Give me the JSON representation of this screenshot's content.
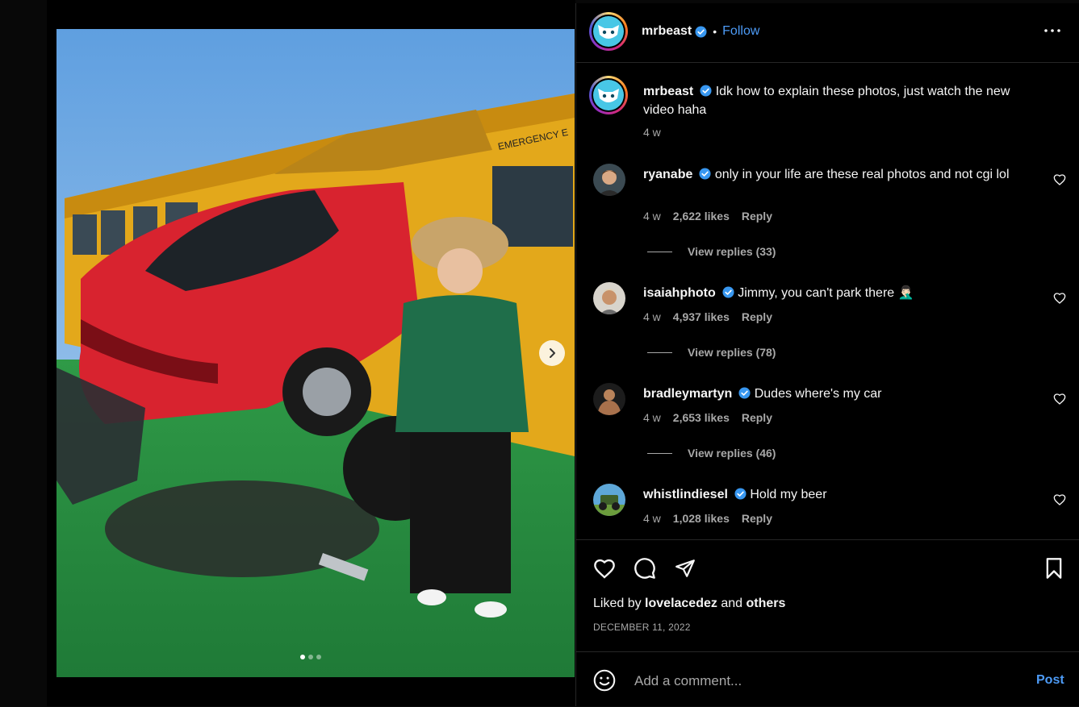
{
  "post": {
    "author": "mrbeast",
    "verified": true,
    "follow_label": "Follow",
    "header_separator": "•",
    "caption": "Idk how to explain these photos, just watch the new video haha",
    "caption_time": "4 w",
    "image_count": 3,
    "current_image": 1,
    "liked_by_prefix": "Liked by",
    "liked_by_user": "lovelacedez",
    "liked_by_and": "and",
    "liked_by_others": "others",
    "date": "DECEMBER 11, 2022"
  },
  "comments": [
    {
      "user": "ryanabe",
      "verified": true,
      "text": "only in your life are these real photos and not cgi lol",
      "time": "4 w",
      "likes": "2,622 likes",
      "reply_label": "Reply",
      "view_replies": "View replies (33)"
    },
    {
      "user": "isaiahphoto",
      "verified": true,
      "text": "Jimmy, you can't park there 🤦🏻‍♂️",
      "time": "4 w",
      "likes": "4,937 likes",
      "reply_label": "Reply",
      "view_replies": "View replies (78)"
    },
    {
      "user": "bradleymartyn",
      "verified": true,
      "text": "Dudes where's my car",
      "time": "4 w",
      "likes": "2,653 likes",
      "reply_label": "Reply",
      "view_replies": "View replies (46)"
    },
    {
      "user": "whistlindiesel",
      "verified": true,
      "text": "Hold my beer",
      "time": "4 w",
      "likes": "1,028 likes",
      "reply_label": "Reply"
    }
  ],
  "add_comment": {
    "placeholder": "Add a comment...",
    "post_label": "Post"
  },
  "icons": {
    "more": "more-horizontal-icon",
    "like": "heart-icon",
    "comment": "comment-bubble-icon",
    "share": "paper-plane-icon",
    "save": "bookmark-icon",
    "emoji": "smiley-icon",
    "next": "chevron-right-icon",
    "verified": "verified-badge-icon"
  },
  "colors": {
    "accent": "#4d9bf6",
    "background": "#000000",
    "muted_text": "#a8a8a8",
    "divider": "#262626"
  }
}
